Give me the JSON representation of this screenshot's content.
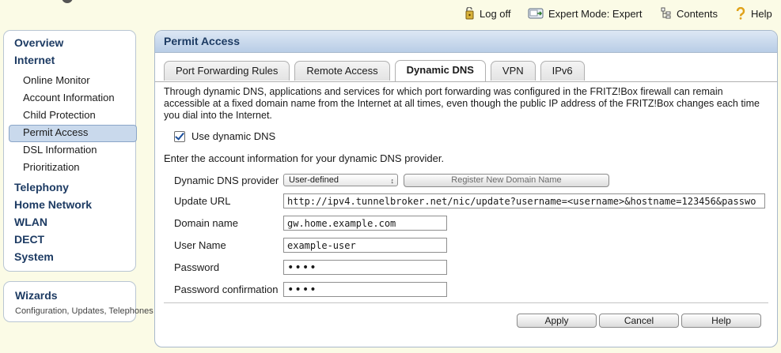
{
  "toolbar": {
    "logoff": "Log off",
    "expert_mode": "Expert Mode: Expert",
    "contents": "Contents",
    "help": "Help"
  },
  "sidebar": {
    "items": [
      {
        "label": "Overview",
        "level": "top"
      },
      {
        "label": "Internet",
        "level": "top"
      },
      {
        "label": "Online Monitor",
        "level": "sub"
      },
      {
        "label": "Account Information",
        "level": "sub"
      },
      {
        "label": "Child Protection",
        "level": "sub"
      },
      {
        "label": "Permit Access",
        "level": "sub",
        "selected": true
      },
      {
        "label": "DSL Information",
        "level": "sub"
      },
      {
        "label": "Prioritization",
        "level": "sub"
      },
      {
        "label": "Telephony",
        "level": "top"
      },
      {
        "label": "Home Network",
        "level": "top"
      },
      {
        "label": "WLAN",
        "level": "top"
      },
      {
        "label": "DECT",
        "level": "top"
      },
      {
        "label": "System",
        "level": "top"
      }
    ],
    "wizards": {
      "title": "Wizards",
      "subtitle": "Configuration, Updates, Telephones"
    }
  },
  "main": {
    "title": "Permit Access",
    "tabs": [
      {
        "label": "Port Forwarding Rules"
      },
      {
        "label": "Remote Access"
      },
      {
        "label": "Dynamic DNS",
        "active": true
      },
      {
        "label": "VPN"
      },
      {
        "label": "IPv6"
      }
    ],
    "intro": "Through dynamic DNS, applications and services for which port forwarding was configured in the FRITZ!Box firewall can remain accessible at a fixed domain name from the Internet at all times, even though the public IP address of the FRITZ!Box changes each time you dial into the Internet.",
    "use_ddns_label": "Use dynamic DNS",
    "use_ddns_checked": true,
    "enter_info": "Enter the account information for your dynamic DNS provider.",
    "form": {
      "provider_label": "Dynamic DNS provider",
      "provider_value": "User-defined",
      "register_button": "Register New Domain Name",
      "update_url_label": "Update URL",
      "update_url_value": "http://ipv4.tunnelbroker.net/nic/update?username=<username>&hostname=123456&passwo",
      "domain_label": "Domain name",
      "domain_value": "gw.home.example.com",
      "username_label": "User Name",
      "username_value": "example-user",
      "password_label": "Password",
      "password_value": "••••",
      "password_confirm_label": "Password confirmation",
      "password_confirm_value": "••••"
    },
    "buttons": {
      "apply": "Apply",
      "cancel": "Cancel",
      "help": "Help"
    }
  },
  "colors": {
    "background": "#fbfbe6",
    "nav_heading": "#1d3b63",
    "selected_item": "#c9d9ec",
    "panel_header": "#b8cde6"
  }
}
